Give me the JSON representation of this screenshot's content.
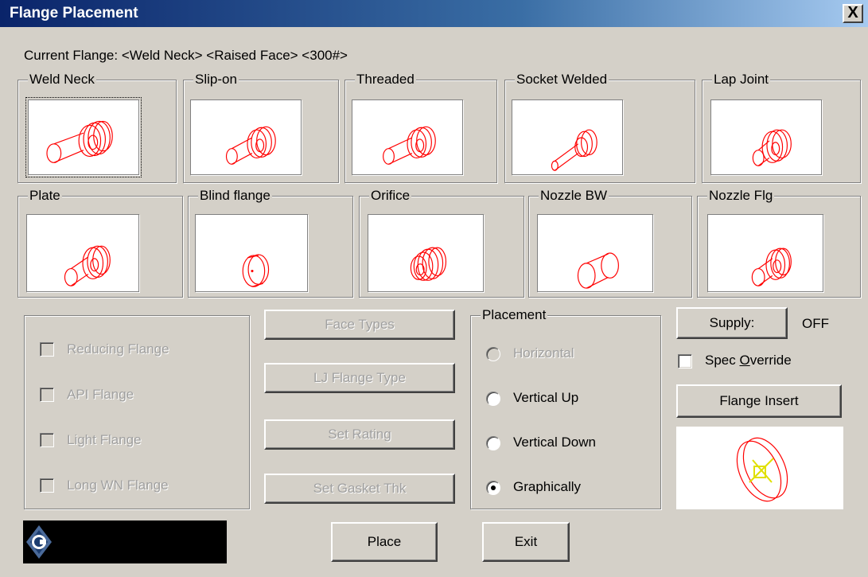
{
  "window": {
    "title": "Flange Placement",
    "close_label": "X"
  },
  "current_flange": "Current Flange: <Weld Neck> <Raised Face> <300#>",
  "flange_types": [
    {
      "label": "Weld Neck",
      "icon": "weld-neck-icon"
    },
    {
      "label": "Slip-on",
      "icon": "slip-on-icon"
    },
    {
      "label": "Threaded",
      "icon": "threaded-icon"
    },
    {
      "label": "Socket Welded",
      "icon": "socket-welded-icon"
    },
    {
      "label": "Lap Joint",
      "icon": "lap-joint-icon"
    },
    {
      "label": "Plate",
      "icon": "plate-icon"
    },
    {
      "label": "Blind flange",
      "icon": "blind-flange-icon"
    },
    {
      "label": "Orifice",
      "icon": "orifice-icon"
    },
    {
      "label": "Nozzle BW",
      "icon": "nozzle-bw-icon"
    },
    {
      "label": "Nozzle Flg",
      "icon": "nozzle-flg-icon"
    }
  ],
  "options": {
    "reducing": "Reducing Flange",
    "api": "API Flange",
    "light": "Light Flange",
    "long_wn": "Long WN Flange"
  },
  "buttons": {
    "face_types": "Face Types",
    "lj_flange_type": "LJ Flange Type",
    "set_rating": "Set Rating",
    "set_gasket": "Set Gasket Thk",
    "place": "Place",
    "exit": "Exit",
    "supply": "Supply:",
    "flange_insert": "Flange Insert"
  },
  "placement": {
    "title": "Placement",
    "horizontal": "Horizontal",
    "vertical_up": "Vertical Up",
    "vertical_down": "Vertical Down",
    "graphically": "Graphically",
    "selected": "Graphically"
  },
  "supply_value": "OFF",
  "spec_override": {
    "before": "Spec ",
    "accel": "O",
    "after": "verride"
  },
  "colors": {
    "drawing": "#ff0000",
    "insert_marker": "#e0e000",
    "titlebar": "#0a246a",
    "face": "#d4d0c8"
  }
}
